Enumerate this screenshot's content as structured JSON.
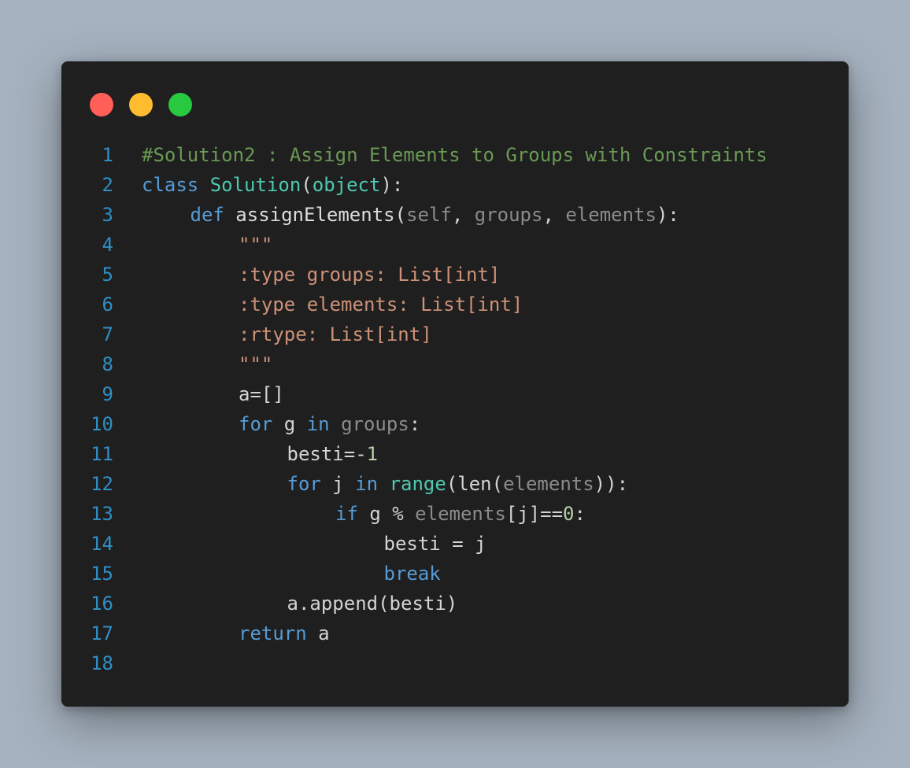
{
  "window": {
    "controls": [
      {
        "name": "close",
        "color": "#ff5f57"
      },
      {
        "name": "minimize",
        "color": "#febc2e"
      },
      {
        "name": "maximize",
        "color": "#28c840"
      }
    ]
  },
  "code": {
    "lines": [
      {
        "n": "1",
        "indent": 0,
        "tokens": [
          {
            "t": "#Solution2 : Assign Elements to Groups with Constraints",
            "k": "comment"
          }
        ]
      },
      {
        "n": "2",
        "indent": 0,
        "tokens": [
          {
            "t": "class",
            "k": "keyword"
          },
          {
            "t": " ",
            "k": "default"
          },
          {
            "t": "Solution",
            "k": "class"
          },
          {
            "t": "(",
            "k": "default"
          },
          {
            "t": "object",
            "k": "builtin"
          },
          {
            "t": "):",
            "k": "default"
          }
        ]
      },
      {
        "n": "3",
        "indent": 1,
        "tokens": [
          {
            "t": "def",
            "k": "keyword"
          },
          {
            "t": " assignElements(",
            "k": "func"
          },
          {
            "t": "self",
            "k": "param"
          },
          {
            "t": ", ",
            "k": "default"
          },
          {
            "t": "groups",
            "k": "param"
          },
          {
            "t": ", ",
            "k": "default"
          },
          {
            "t": "elements",
            "k": "param"
          },
          {
            "t": "):",
            "k": "default"
          }
        ]
      },
      {
        "n": "4",
        "indent": 2,
        "tokens": [
          {
            "t": "\"\"\"",
            "k": "string"
          }
        ]
      },
      {
        "n": "5",
        "indent": 2,
        "tokens": [
          {
            "t": ":type groups: List[int]",
            "k": "string"
          }
        ]
      },
      {
        "n": "6",
        "indent": 2,
        "tokens": [
          {
            "t": ":type elements: List[int]",
            "k": "string"
          }
        ]
      },
      {
        "n": "7",
        "indent": 2,
        "tokens": [
          {
            "t": ":rtype: List[int]",
            "k": "string"
          }
        ]
      },
      {
        "n": "8",
        "indent": 2,
        "tokens": [
          {
            "t": "\"\"\"",
            "k": "string"
          }
        ]
      },
      {
        "n": "9",
        "indent": 2,
        "tokens": [
          {
            "t": "a=[]",
            "k": "default"
          }
        ]
      },
      {
        "n": "10",
        "indent": 2,
        "tokens": [
          {
            "t": "for",
            "k": "keyword"
          },
          {
            "t": " g ",
            "k": "default"
          },
          {
            "t": "in",
            "k": "keyword"
          },
          {
            "t": " ",
            "k": "default"
          },
          {
            "t": "groups",
            "k": "param"
          },
          {
            "t": ":",
            "k": "default"
          }
        ]
      },
      {
        "n": "11",
        "indent": 3,
        "tokens": [
          {
            "t": "besti=-",
            "k": "default"
          },
          {
            "t": "1",
            "k": "number"
          }
        ]
      },
      {
        "n": "12",
        "indent": 3,
        "tokens": [
          {
            "t": "for",
            "k": "keyword"
          },
          {
            "t": " j ",
            "k": "default"
          },
          {
            "t": "in",
            "k": "keyword"
          },
          {
            "t": " ",
            "k": "default"
          },
          {
            "t": "range",
            "k": "builtin"
          },
          {
            "t": "(len(",
            "k": "default"
          },
          {
            "t": "elements",
            "k": "param"
          },
          {
            "t": ")):",
            "k": "default"
          }
        ]
      },
      {
        "n": "13",
        "indent": 4,
        "tokens": [
          {
            "t": "if",
            "k": "keyword"
          },
          {
            "t": " g ",
            "k": "default"
          },
          {
            "t": "%",
            "k": "default"
          },
          {
            "t": " ",
            "k": "default"
          },
          {
            "t": "elements",
            "k": "param"
          },
          {
            "t": "[j]==",
            "k": "default"
          },
          {
            "t": "0",
            "k": "number"
          },
          {
            "t": ":",
            "k": "default"
          }
        ]
      },
      {
        "n": "14",
        "indent": 5,
        "tokens": [
          {
            "t": "besti = j",
            "k": "default"
          }
        ]
      },
      {
        "n": "15",
        "indent": 5,
        "tokens": [
          {
            "t": "break",
            "k": "keyword"
          }
        ]
      },
      {
        "n": "16",
        "indent": 3,
        "tokens": [
          {
            "t": "a.append(besti)",
            "k": "default"
          }
        ]
      },
      {
        "n": "17",
        "indent": 2,
        "tokens": [
          {
            "t": "return",
            "k": "keyword"
          },
          {
            "t": " a",
            "k": "default"
          }
        ]
      },
      {
        "n": "18",
        "indent": 0,
        "tokens": []
      }
    ]
  }
}
